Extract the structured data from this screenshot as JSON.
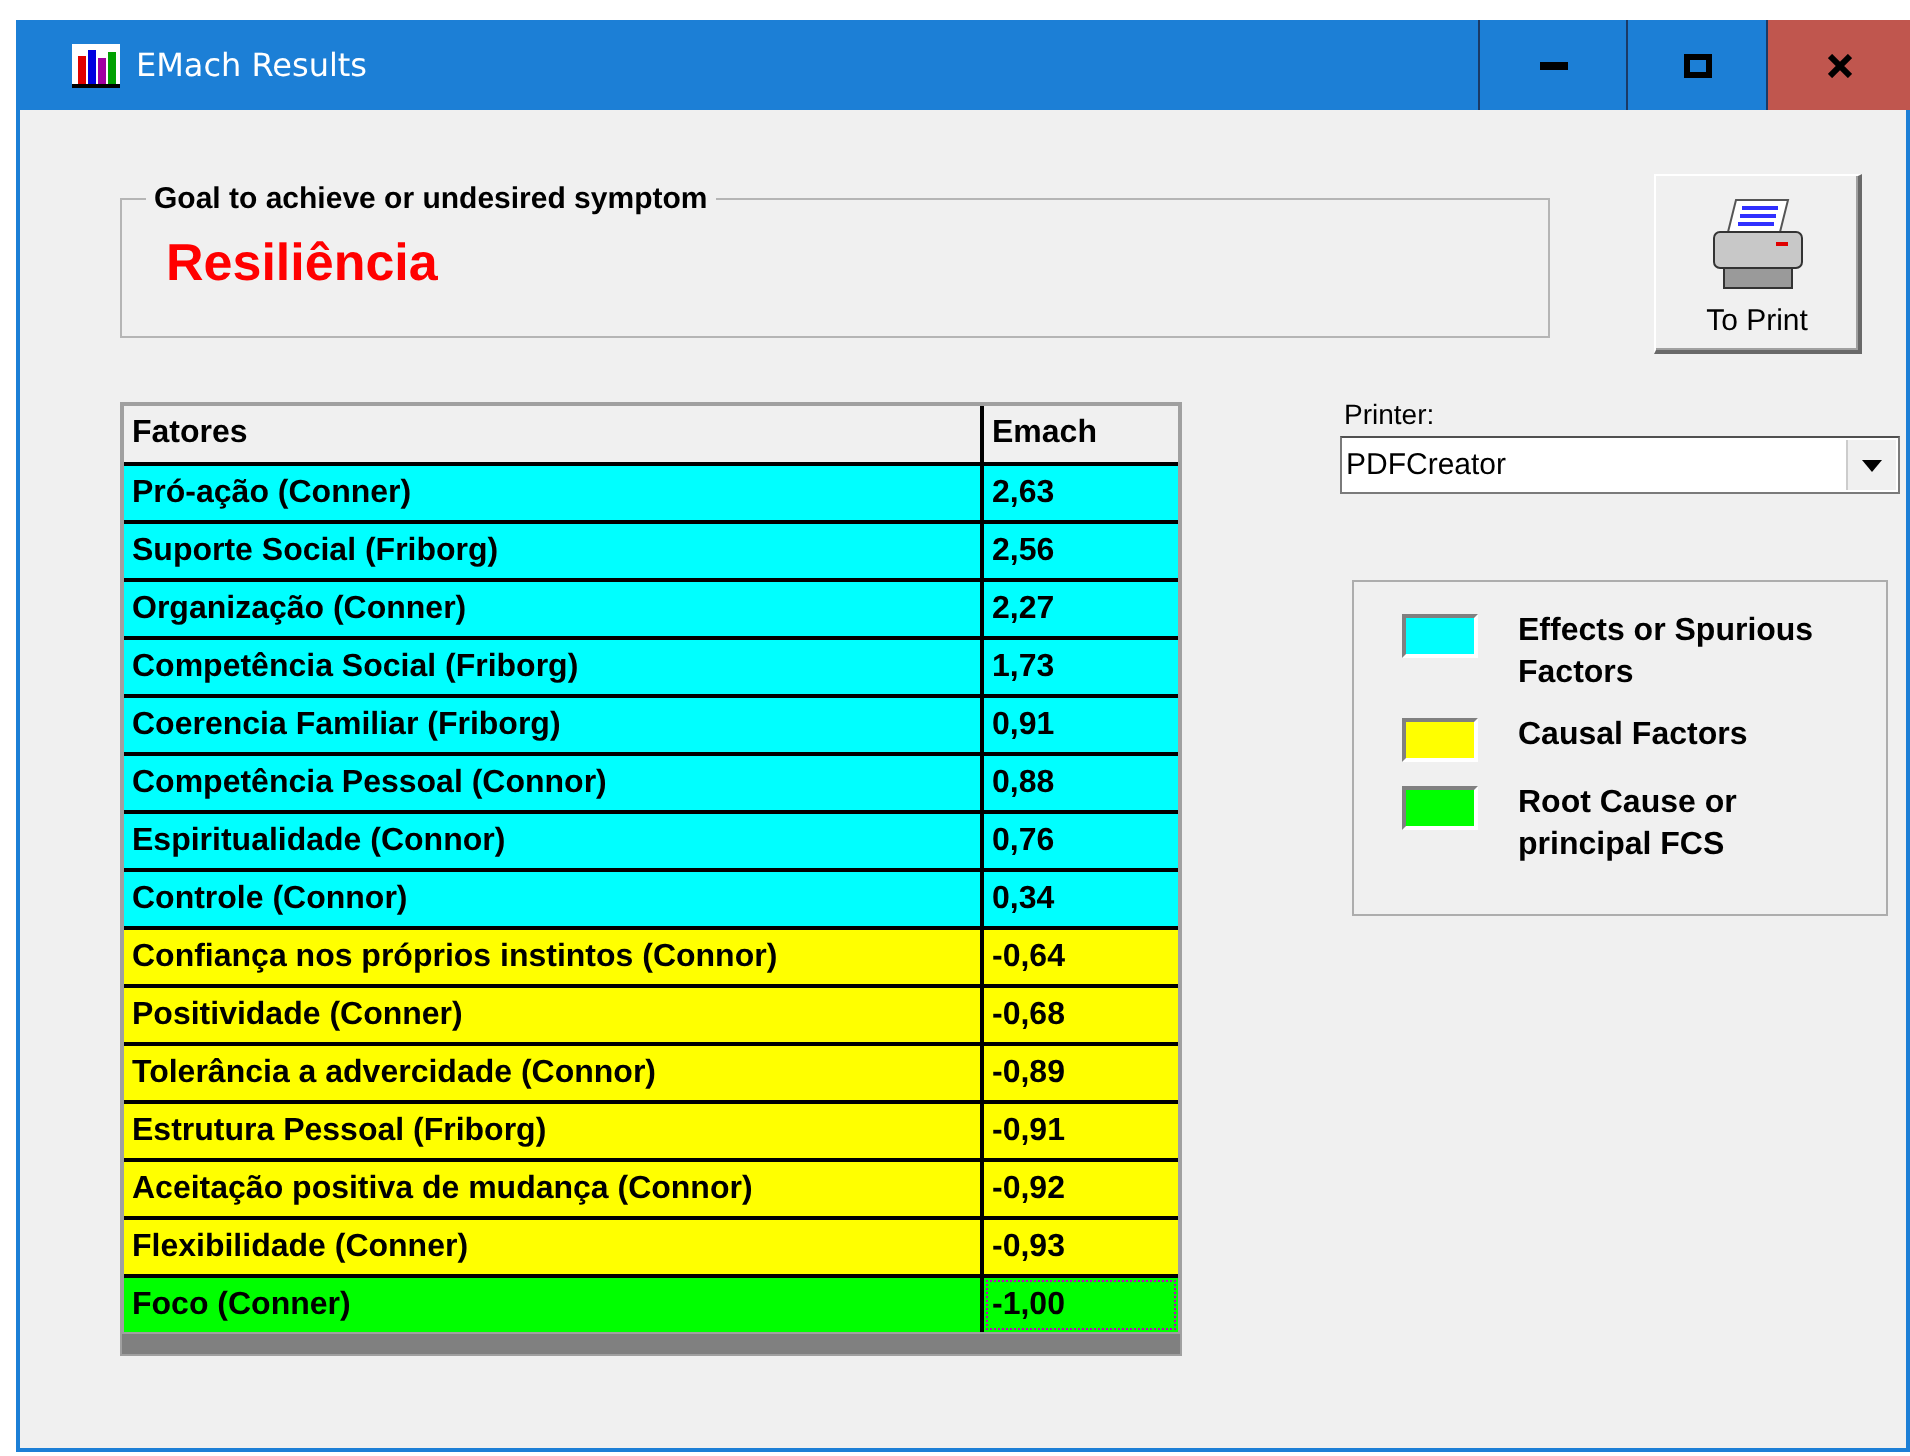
{
  "window": {
    "title": "EMach Results",
    "controls": [
      {
        "kind": "minimize"
      },
      {
        "kind": "maximize"
      },
      {
        "kind": "close"
      }
    ]
  },
  "goal": {
    "legend": "Goal to achieve or undesired symptom",
    "value": "Resiliência"
  },
  "print_button": {
    "label": "To Print"
  },
  "table": {
    "columns": [
      "Fatores",
      "Emach"
    ],
    "rows": [
      {
        "factor": "Pró-ação  (Conner)",
        "emach": "2,63",
        "color": "#00ffff",
        "selected": false
      },
      {
        "factor": "Suporte Social (Friborg)",
        "emach": "2,56",
        "color": "#00ffff",
        "selected": false
      },
      {
        "factor": "Organização  (Conner)",
        "emach": "2,27",
        "color": "#00ffff",
        "selected": false
      },
      {
        "factor": "Competência Social (Friborg)",
        "emach": "1,73",
        "color": "#00ffff",
        "selected": false
      },
      {
        "factor": "Coerencia Familiar (Friborg)",
        "emach": "0,91",
        "color": "#00ffff",
        "selected": false
      },
      {
        "factor": "Competência Pessoal (Connor)",
        "emach": "0,88",
        "color": "#00ffff",
        "selected": false
      },
      {
        "factor": "Espiritualidade (Connor)",
        "emach": "0,76",
        "color": "#00ffff",
        "selected": false
      },
      {
        "factor": "Controle (Connor)",
        "emach": "0,34",
        "color": "#00ffff",
        "selected": false
      },
      {
        "factor": "Confiança nos próprios instintos (Connor)",
        "emach": "-0,64",
        "color": "#ffff00",
        "selected": false
      },
      {
        "factor": "Positividade (Conner)",
        "emach": "-0,68",
        "color": "#ffff00",
        "selected": false
      },
      {
        "factor": "Tolerância a advercidade (Connor)",
        "emach": "-0,89",
        "color": "#ffff00",
        "selected": false
      },
      {
        "factor": "Estrutura Pessoal (Friborg)",
        "emach": "-0,91",
        "color": "#ffff00",
        "selected": false
      },
      {
        "factor": "Aceitação positiva de mudança (Connor)",
        "emach": "-0,92",
        "color": "#ffff00",
        "selected": false
      },
      {
        "factor": "Flexibilidade (Conner)",
        "emach": "-0,93",
        "color": "#ffff00",
        "selected": false
      },
      {
        "factor": "Foco (Conner)",
        "emach": "-1,00",
        "color": "#00ff00",
        "selected": true
      }
    ]
  },
  "printer": {
    "label": "Printer:",
    "value": "PDFCreator"
  },
  "legend": [
    {
      "label": "Effects or Spurious Factors",
      "color": "#00ffff"
    },
    {
      "label": "Causal Factors",
      "color": "#ffff00"
    },
    {
      "label": "Root Cause or principal FCS",
      "color": "#00ff00"
    }
  ]
}
